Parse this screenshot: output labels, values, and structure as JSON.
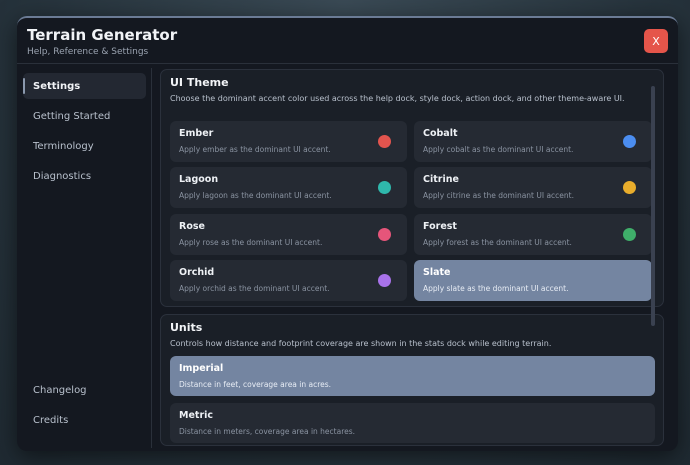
{
  "window": {
    "title": "Terrain Generator",
    "subtitle": "Help, Reference & Settings",
    "close_label": "X"
  },
  "sidebar": {
    "items": [
      {
        "label": "Settings",
        "active": true
      },
      {
        "label": "Getting Started",
        "active": false
      },
      {
        "label": "Terminology",
        "active": false
      },
      {
        "label": "Diagnostics",
        "active": false
      },
      {
        "label": "Changelog",
        "active": false
      },
      {
        "label": "Credits",
        "active": false
      }
    ]
  },
  "theme_section": {
    "title": "UI Theme",
    "description": "Choose the dominant accent color used across the help dock, style dock, action dock, and other theme-aware UI.",
    "options": [
      {
        "name": "Ember",
        "desc": "Apply ember as the dominant UI accent.",
        "color": "#e2544e",
        "selected": false
      },
      {
        "name": "Cobalt",
        "desc": "Apply cobalt as the dominant UI accent.",
        "color": "#4b8df0",
        "selected": false
      },
      {
        "name": "Lagoon",
        "desc": "Apply lagoon as the dominant UI accent.",
        "color": "#2fb8ac",
        "selected": false
      },
      {
        "name": "Citrine",
        "desc": "Apply citrine as the dominant UI accent.",
        "color": "#e9ad2c",
        "selected": false
      },
      {
        "name": "Rose",
        "desc": "Apply rose as the dominant UI accent.",
        "color": "#e6557a",
        "selected": false
      },
      {
        "name": "Forest",
        "desc": "Apply forest as the dominant UI accent.",
        "color": "#3fae6a",
        "selected": false
      },
      {
        "name": "Orchid",
        "desc": "Apply orchid as the dominant UI accent.",
        "color": "#a872ea",
        "selected": false
      },
      {
        "name": "Slate",
        "desc": "Apply slate as the dominant UI accent.",
        "color": "#7485a1",
        "selected": true
      }
    ]
  },
  "units_section": {
    "title": "Units",
    "description": "Controls how distance and footprint coverage are shown in the stats dock while editing terrain.",
    "options": [
      {
        "name": "Imperial",
        "desc": "Distance in feet, coverage area in acres.",
        "selected": true
      },
      {
        "name": "Metric",
        "desc": "Distance in meters, coverage area in hectares.",
        "selected": false
      }
    ]
  },
  "colors": {
    "close_button": "#e5554a",
    "selected_accent": "#7485a1"
  }
}
